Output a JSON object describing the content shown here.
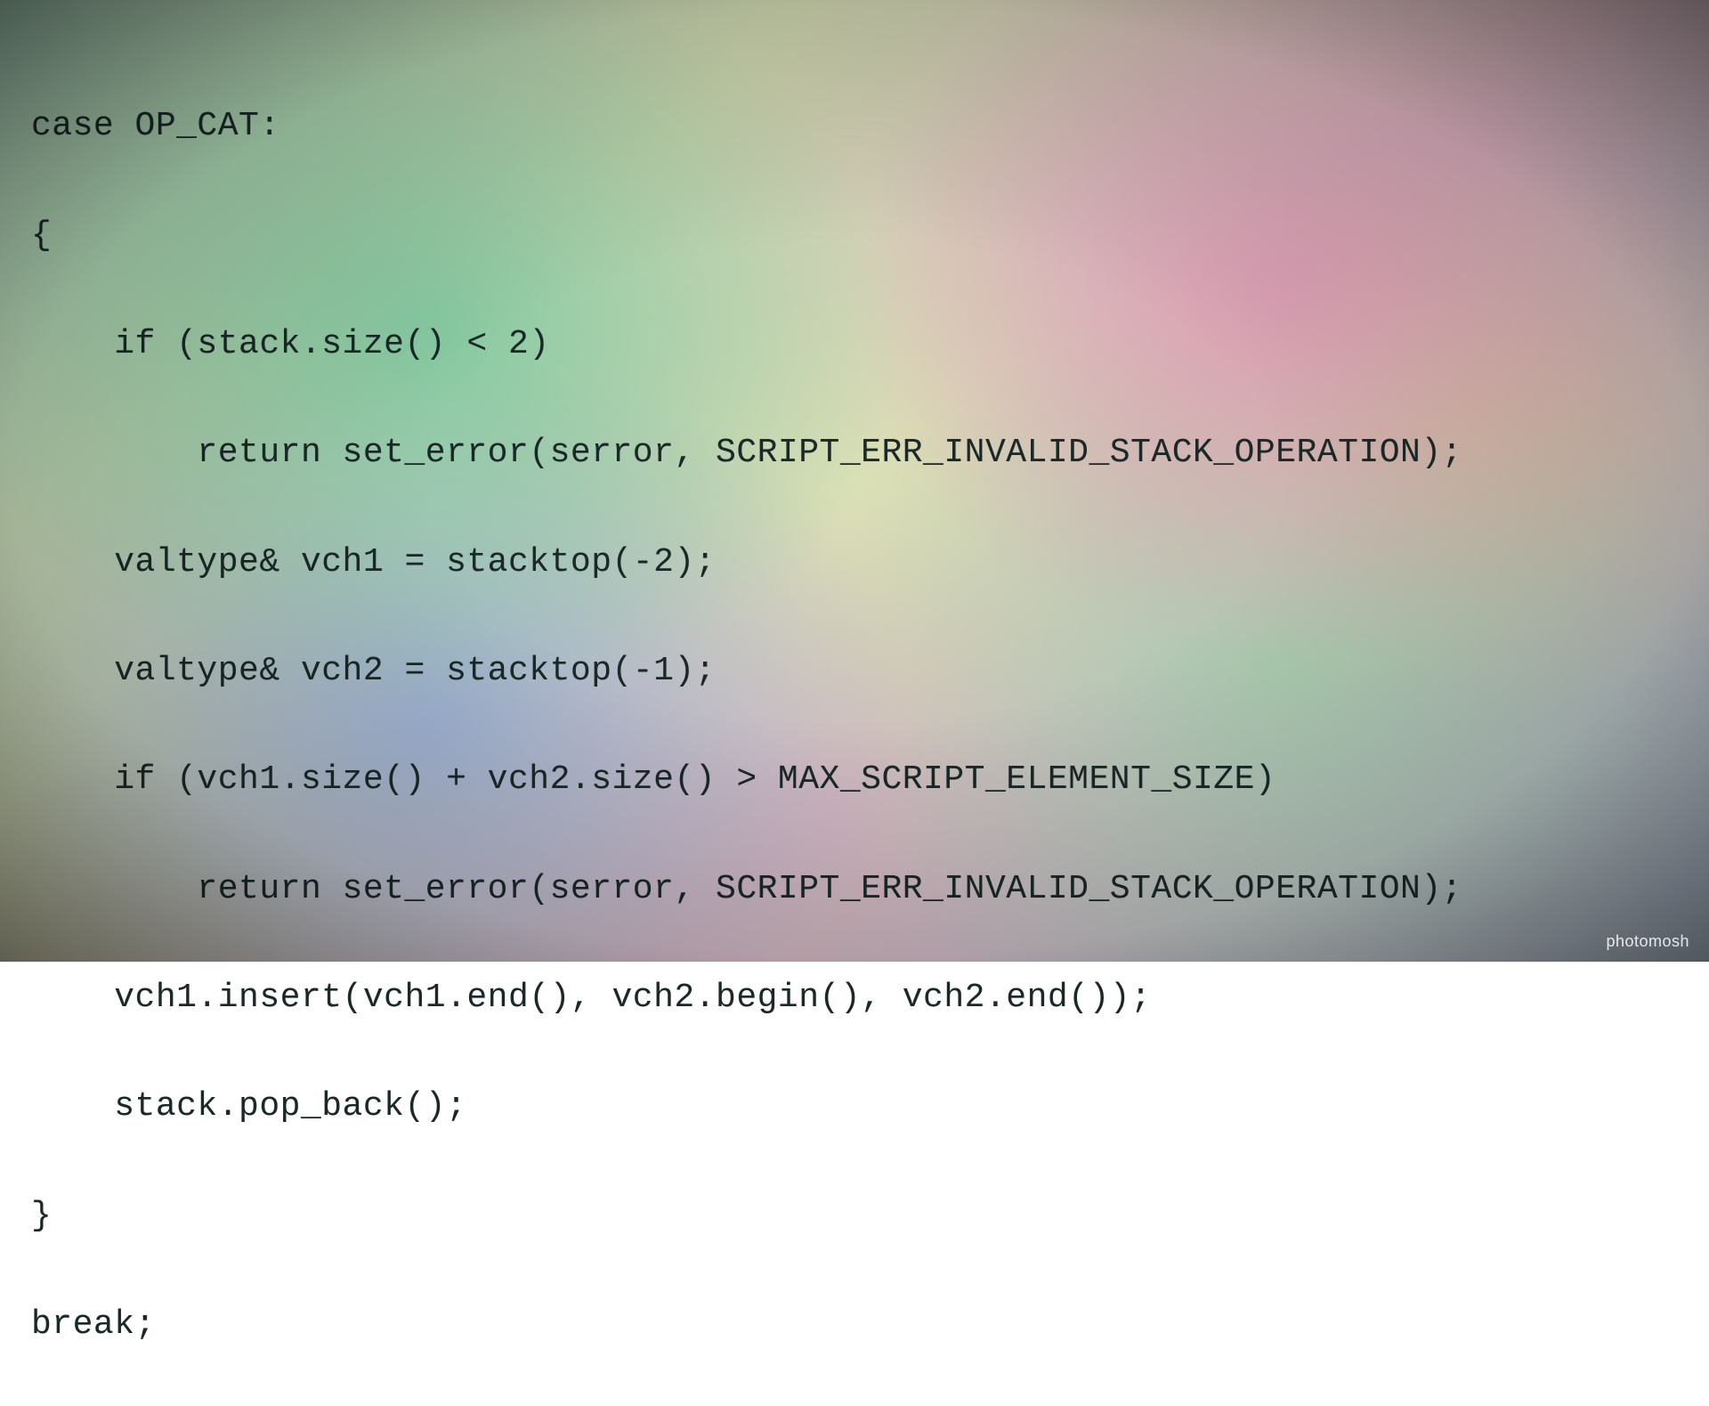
{
  "code": {
    "lines": [
      "case OP_CAT:",
      "{",
      "    if (stack.size() < 2)",
      "        return set_error(serror, SCRIPT_ERR_INVALID_STACK_OPERATION);",
      "    valtype& vch1 = stacktop(-2);",
      "    valtype& vch2 = stacktop(-1);",
      "    if (vch1.size() + vch2.size() > MAX_SCRIPT_ELEMENT_SIZE)",
      "        return set_error(serror, SCRIPT_ERR_INVALID_STACK_OPERATION);",
      "    vch1.insert(vch1.end(), vch2.begin(), vch2.end());",
      "    stack.pop_back();",
      "}",
      "break;"
    ]
  },
  "watermark": "photomosh"
}
